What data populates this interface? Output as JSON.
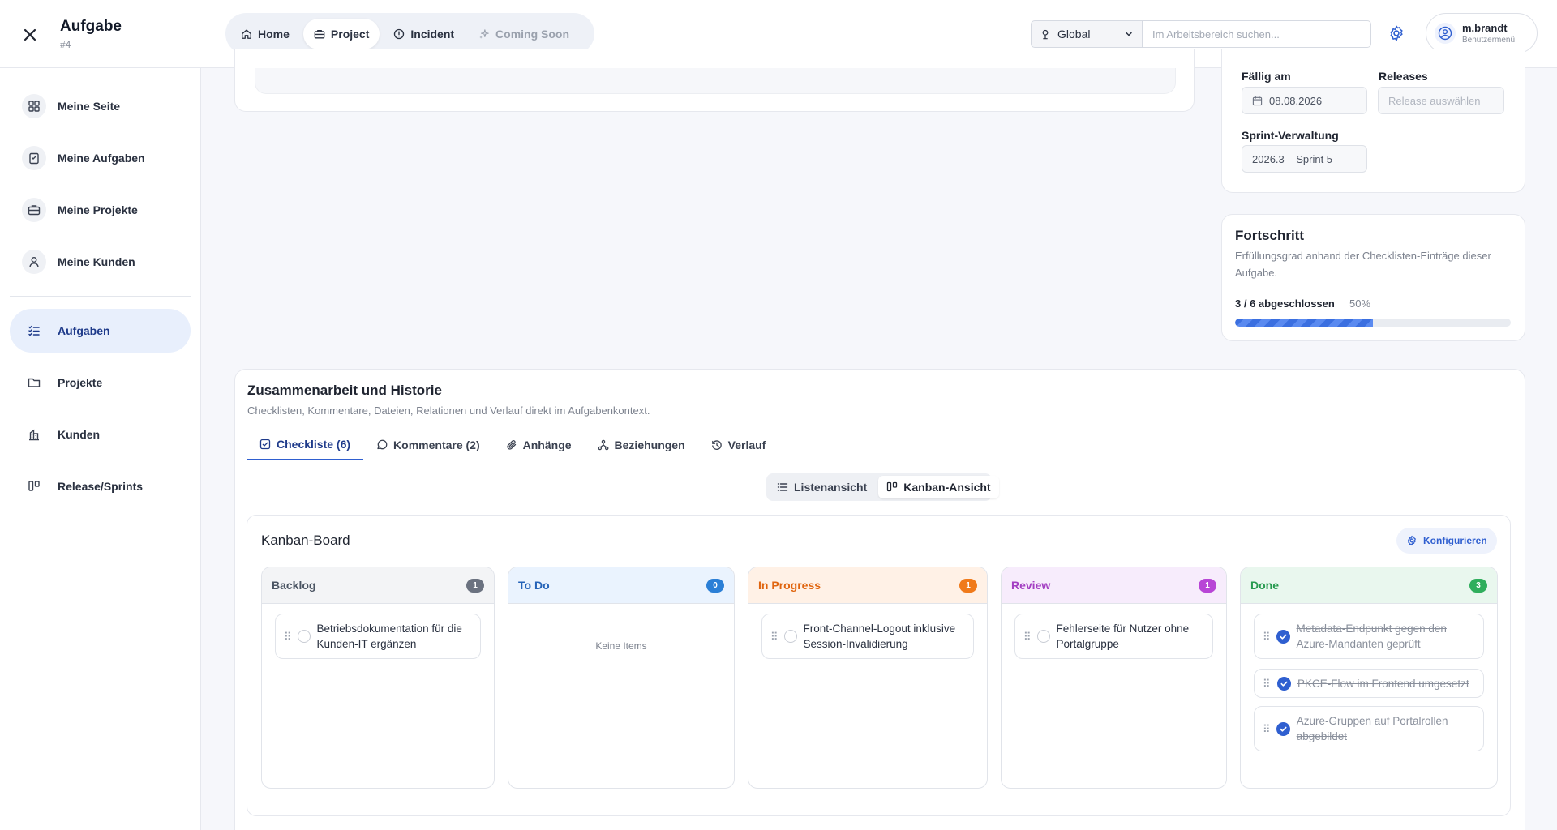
{
  "header": {
    "title": "Aufgabe",
    "subtitle": "#4",
    "nav": [
      {
        "label": "Home",
        "icon": "home-icon"
      },
      {
        "label": "Project",
        "icon": "briefcase-icon"
      },
      {
        "label": "Incident",
        "icon": "alert-circle-icon"
      },
      {
        "label": "Coming Soon",
        "icon": "sparkles-icon"
      }
    ],
    "scope_label": "Global",
    "search_placeholder": "Im Arbeitsbereich suchen...",
    "user_name": "m.brandt",
    "user_role": "Benutzermenü"
  },
  "sidebar": {
    "items": [
      {
        "label": "Meine Seite",
        "icon": "dashboard-icon"
      },
      {
        "label": "Meine Aufgaben",
        "icon": "clipboard-icon"
      },
      {
        "label": "Meine Projekte",
        "icon": "briefcase-icon"
      },
      {
        "label": "Meine Kunden",
        "icon": "user-icon"
      },
      {
        "label": "Aufgaben",
        "icon": "checklist-icon"
      },
      {
        "label": "Projekte",
        "icon": "folder-icon"
      },
      {
        "label": "Kunden",
        "icon": "building-icon"
      },
      {
        "label": "Release/Sprints",
        "icon": "kanban-icon"
      }
    ]
  },
  "details": {
    "due_label": "Fällig am",
    "due_value": "08.08.2026",
    "releases_label": "Releases",
    "releases_placeholder": "Release auswählen",
    "sprint_label": "Sprint-Verwaltung",
    "sprint_value": "2026.3 – Sprint 5"
  },
  "progress": {
    "title": "Fortschritt",
    "description": "Erfüllungsgrad anhand der Checklisten-Einträge dieser Aufgabe.",
    "status": "3 / 6 abgeschlossen",
    "percent_label": "50%",
    "fraction": 0.5
  },
  "collab": {
    "title": "Zusammenarbeit und Historie",
    "subtitle": "Checklisten, Kommentare, Dateien, Relationen und Verlauf direkt im Aufgabenkontext.",
    "tabs": [
      {
        "label": "Checkliste (6)",
        "icon": "checkbox-icon"
      },
      {
        "label": "Kommentare (2)",
        "icon": "comment-icon"
      },
      {
        "label": "Anhänge",
        "icon": "paperclip-icon"
      },
      {
        "label": "Beziehungen",
        "icon": "relations-icon"
      },
      {
        "label": "Verlauf",
        "icon": "history-icon"
      }
    ],
    "views": [
      {
        "label": "Listenansicht",
        "icon": "list-icon"
      },
      {
        "label": "Kanban-Ansicht",
        "icon": "kanban-icon"
      }
    ]
  },
  "kanban": {
    "title": "Kanban-Board",
    "configure_label": "Konfigurieren",
    "empty_text": "Keine Items",
    "columns": [
      {
        "name": "Backlog",
        "count": "1",
        "head_color": "#f3f4f6",
        "text_color": "#4b5563",
        "badge_color": "#6b7280",
        "items": [
          {
            "text": "Betriebsdokumentation für die Kunden-IT ergänzen",
            "done": false
          }
        ]
      },
      {
        "name": "To Do",
        "count": "0",
        "head_color": "#eaf3fe",
        "text_color": "#2563b8",
        "badge_color": "#2b7fd6",
        "items": []
      },
      {
        "name": "In Progress",
        "count": "1",
        "head_color": "#fff1e6",
        "text_color": "#e0650f",
        "badge_color": "#f07a1a",
        "items": [
          {
            "text": "Front-Channel-Logout inklusive Session-Invalidierung",
            "done": false
          }
        ]
      },
      {
        "name": "Review",
        "count": "1",
        "head_color": "#f7ecfc",
        "text_color": "#a33ec2",
        "badge_color": "#b845d6",
        "items": [
          {
            "text": "Fehlerseite für Nutzer ohne Portalgruppe",
            "done": false
          }
        ]
      },
      {
        "name": "Done",
        "count": "3",
        "head_color": "#e9f7ee",
        "text_color": "#279a4f",
        "badge_color": "#2fae5c",
        "items": [
          {
            "text": "Metadata-Endpunkt gegen den Azure-Mandanten geprüft",
            "done": true
          },
          {
            "text": "PKCE-Flow im Frontend umgesetzt",
            "done": true
          },
          {
            "text": "Azure-Gruppen auf Portalrollen abgebildet",
            "done": true
          }
        ]
      }
    ]
  },
  "colors": {
    "accent": "#2f5fd0",
    "active_nav_bg": "#e8effc"
  }
}
